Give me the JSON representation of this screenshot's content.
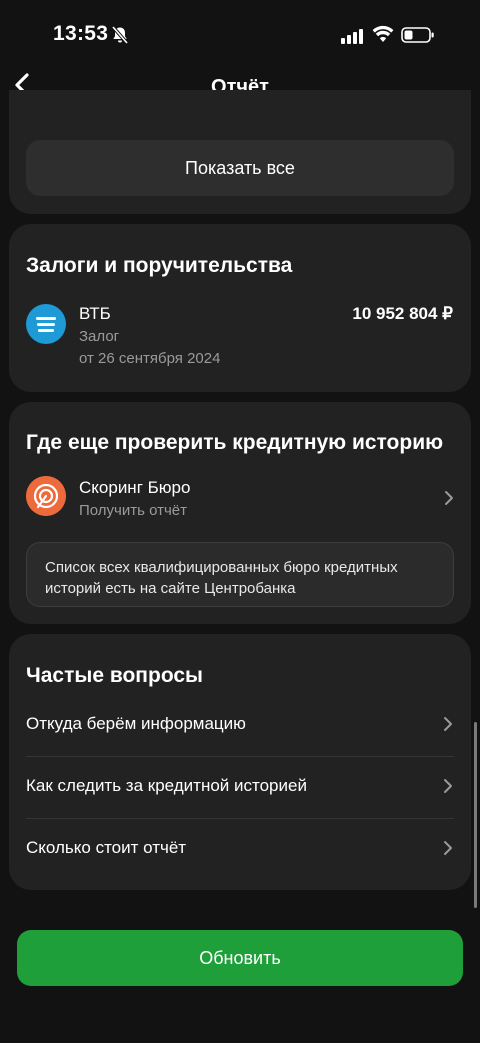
{
  "status_bar": {
    "time": "13:53"
  },
  "nav": {
    "title": "Отчёт"
  },
  "top_card": {
    "show_all_label": "Показать все"
  },
  "collateral": {
    "title": "Залоги и поручительства",
    "item": {
      "bank": "ВТБ",
      "amount": "10 952 804 ₽",
      "type": "Залог",
      "date": "от 26 сентября 2024"
    }
  },
  "where_check": {
    "title": "Где еще проверить кредитную историю",
    "bureau": {
      "name": "Скоринг Бюро",
      "subtitle": "Получить отчёт"
    },
    "info": "Список всех квалифицированных бюро кредитных историй есть на сайте Центробанка"
  },
  "faq": {
    "title": "Частые вопросы",
    "items": [
      {
        "label": "Откуда берём информацию"
      },
      {
        "label": "Как следить за кредитной историей"
      },
      {
        "label": "Сколько стоит отчёт"
      }
    ]
  },
  "update_button": {
    "label": "Обновить"
  },
  "colors": {
    "background": "#121212",
    "card": "#222222",
    "accent_green": "#1f9f3a",
    "vtb_blue": "#1e9bd7",
    "bureau_orange": "#ec6a3c"
  }
}
